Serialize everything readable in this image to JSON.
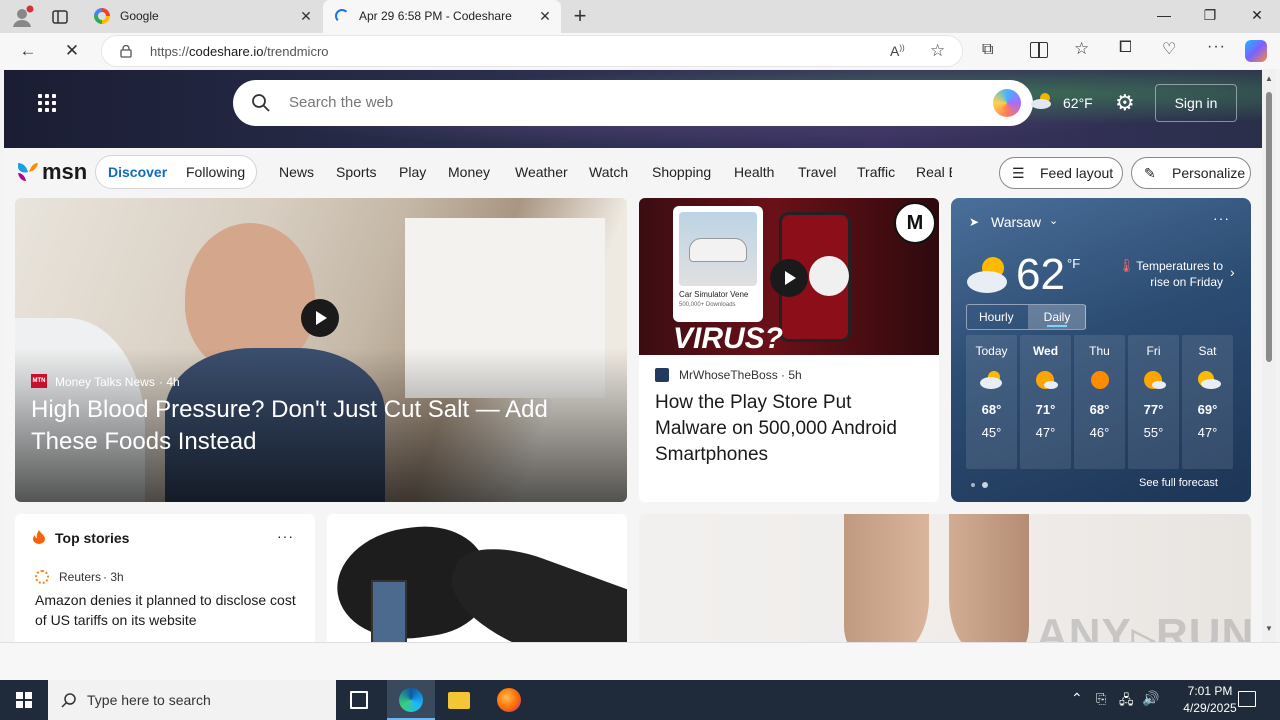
{
  "browser": {
    "tabs": [
      {
        "title": "Google",
        "active": false
      },
      {
        "title": "Apr 29 6:58 PM - Codeshare",
        "active": true
      }
    ],
    "url_prefix": "https://",
    "url_domain": "codeshare.io",
    "url_path": "/trendmicro"
  },
  "msn": {
    "search_placeholder": "Search the web",
    "weather_mini": "62°F",
    "sign_in": "Sign in",
    "logo_text": "msn",
    "tabs": [
      "Discover",
      "Following"
    ],
    "nav_items": [
      "News",
      "Sports",
      "Play",
      "Money",
      "Weather",
      "Watch",
      "Shopping",
      "Health",
      "Travel",
      "Traffic",
      "Real E"
    ],
    "feed_layout": "Feed layout",
    "personalize": "Personalize"
  },
  "cards": {
    "hero": {
      "source": "Money Talks News",
      "source_badge": "MTN",
      "age": "· 4h",
      "headline": "High Blood Pressure? Don't Just Cut Salt — Add These Foods Instead"
    },
    "android": {
      "image_text": "VIRUS?",
      "image_caption": "Car Simulator Vene",
      "image_caption2": "500,000+ Downloads",
      "source": "MrWhoseTheBoss",
      "age": "· 5h",
      "headline": "How the Play Store Put Malware on 500,000 Android Smartphones"
    },
    "top_stories": {
      "title": "Top stories",
      "source": "Reuters",
      "age": "· 3h",
      "headline": "Amazon denies it planned to disclose cost of US tariffs on its website"
    }
  },
  "weather": {
    "city": "Warsaw",
    "temp": "62",
    "unit": "°F",
    "note": "Temperatures to rise on Friday",
    "tabs": [
      "Hourly",
      "Daily"
    ],
    "active_tab": "Daily",
    "days": [
      {
        "day": "Today",
        "high": "68°",
        "low": "45°",
        "icon": "partly-cloudy-icon"
      },
      {
        "day": "Wed",
        "high": "71°",
        "low": "47°",
        "icon": "mostly-sunny-icon"
      },
      {
        "day": "Thu",
        "high": "68°",
        "low": "46°",
        "icon": "sunny-icon"
      },
      {
        "day": "Fri",
        "high": "77°",
        "low": "55°",
        "icon": "mostly-sunny-icon"
      },
      {
        "day": "Sat",
        "high": "69°",
        "low": "47°",
        "icon": "partly-sunny-icon"
      }
    ],
    "see_full": "See full forecast"
  },
  "taskbar": {
    "search_placeholder": "Type here to search",
    "time": "7:01 PM",
    "date": "4/29/2025"
  },
  "watermark": "ANY RUN",
  "colors": {
    "accent": "#0f6cbd",
    "taskbar": "#1f2b3a",
    "weather_bg": "#2f4f74"
  }
}
